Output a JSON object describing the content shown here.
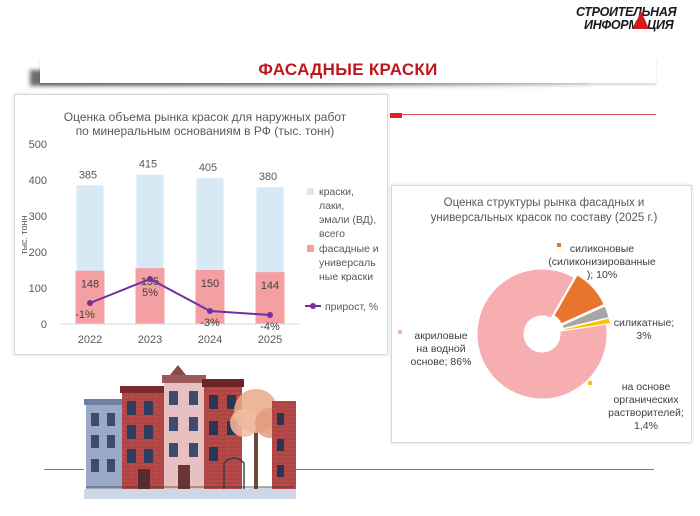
{
  "logo": {
    "line1": "СТРОИТЕЛЬНАЯ",
    "line2": "ИНФОРМАЦИЯ"
  },
  "page": {
    "title": "ФАСАДНЫЕ КРАСКИ"
  },
  "colors": {
    "accent_red": "#c0161d",
    "bar_light": "#d6e9f5",
    "bar_pink": "#f4a0a3",
    "line_purple": "#7030a0",
    "pie_pink": "#f6aeb0",
    "pie_orange": "#e8742e",
    "pie_gray": "#a6a6a6",
    "pie_yellow": "#ffc000"
  },
  "chart_data": [
    {
      "type": "bar",
      "title": "Оценка объема рынка  красок для наружных работ по минеральным основаниям в РФ   (тыс. тонн)",
      "title_lines": [
        "Оценка объема рынка  красок для наружных работ",
        "по минеральным основаниям в РФ   (тыс. тонн)"
      ],
      "ylabel": "тыс. тонн",
      "ylim": [
        0,
        500
      ],
      "yticks": [
        "0",
        "100",
        "200",
        "300",
        "400",
        "500"
      ],
      "categories": [
        "2022",
        "2023",
        "2024",
        "2025"
      ],
      "series": [
        {
          "name": "краски, лаки, эмали (ВД), всего",
          "name_lines": [
            "краски,",
            "лаки,",
            "эмали (ВД),",
            "всего"
          ],
          "values": [
            385,
            415,
            405,
            380
          ],
          "labels": [
            "385",
            "415",
            "405",
            "380"
          ]
        },
        {
          "name": "фасадные и универсальные краски",
          "name_lines": [
            "фасадные и",
            "универсаль",
            "ные краски"
          ],
          "values": [
            148,
            155,
            150,
            144
          ],
          "labels": [
            "148",
            "155",
            "150",
            "144"
          ]
        },
        {
          "name": "прирост, %",
          "type": "line",
          "values": [
            -1,
            5,
            -3,
            -4
          ],
          "labels": [
            "-1%",
            "5%",
            "-3%",
            "-4%"
          ]
        }
      ],
      "legend_position": "right",
      "grid": false
    },
    {
      "type": "pie",
      "title": "Оценка структуры рынка фасадных и универсальных красок по составу  (2025 г.)",
      "title_lines": [
        "Оценка структуры рынка фасадных и",
        "универсальных красок по составу  (2025 г.)"
      ],
      "slices": [
        {
          "name": "силиконовые (силиконизированные)",
          "value": 10,
          "label_lines": [
            "силиконовые",
            "(силиконизированные",
            "); 10%"
          ]
        },
        {
          "name": "силикатные",
          "value": 3,
          "label_lines": [
            "силикатные;",
            "3%"
          ]
        },
        {
          "name": "на основе органических растворителей",
          "value": 1.4,
          "label_lines": [
            "на основе",
            "органических",
            "растворителей;",
            "1,4%"
          ]
        },
        {
          "name": "акриловые на водной основе",
          "value": 86,
          "label_lines": [
            "акриловые",
            "на водной",
            "основе; 86%"
          ]
        }
      ],
      "style": "doughnut"
    }
  ]
}
